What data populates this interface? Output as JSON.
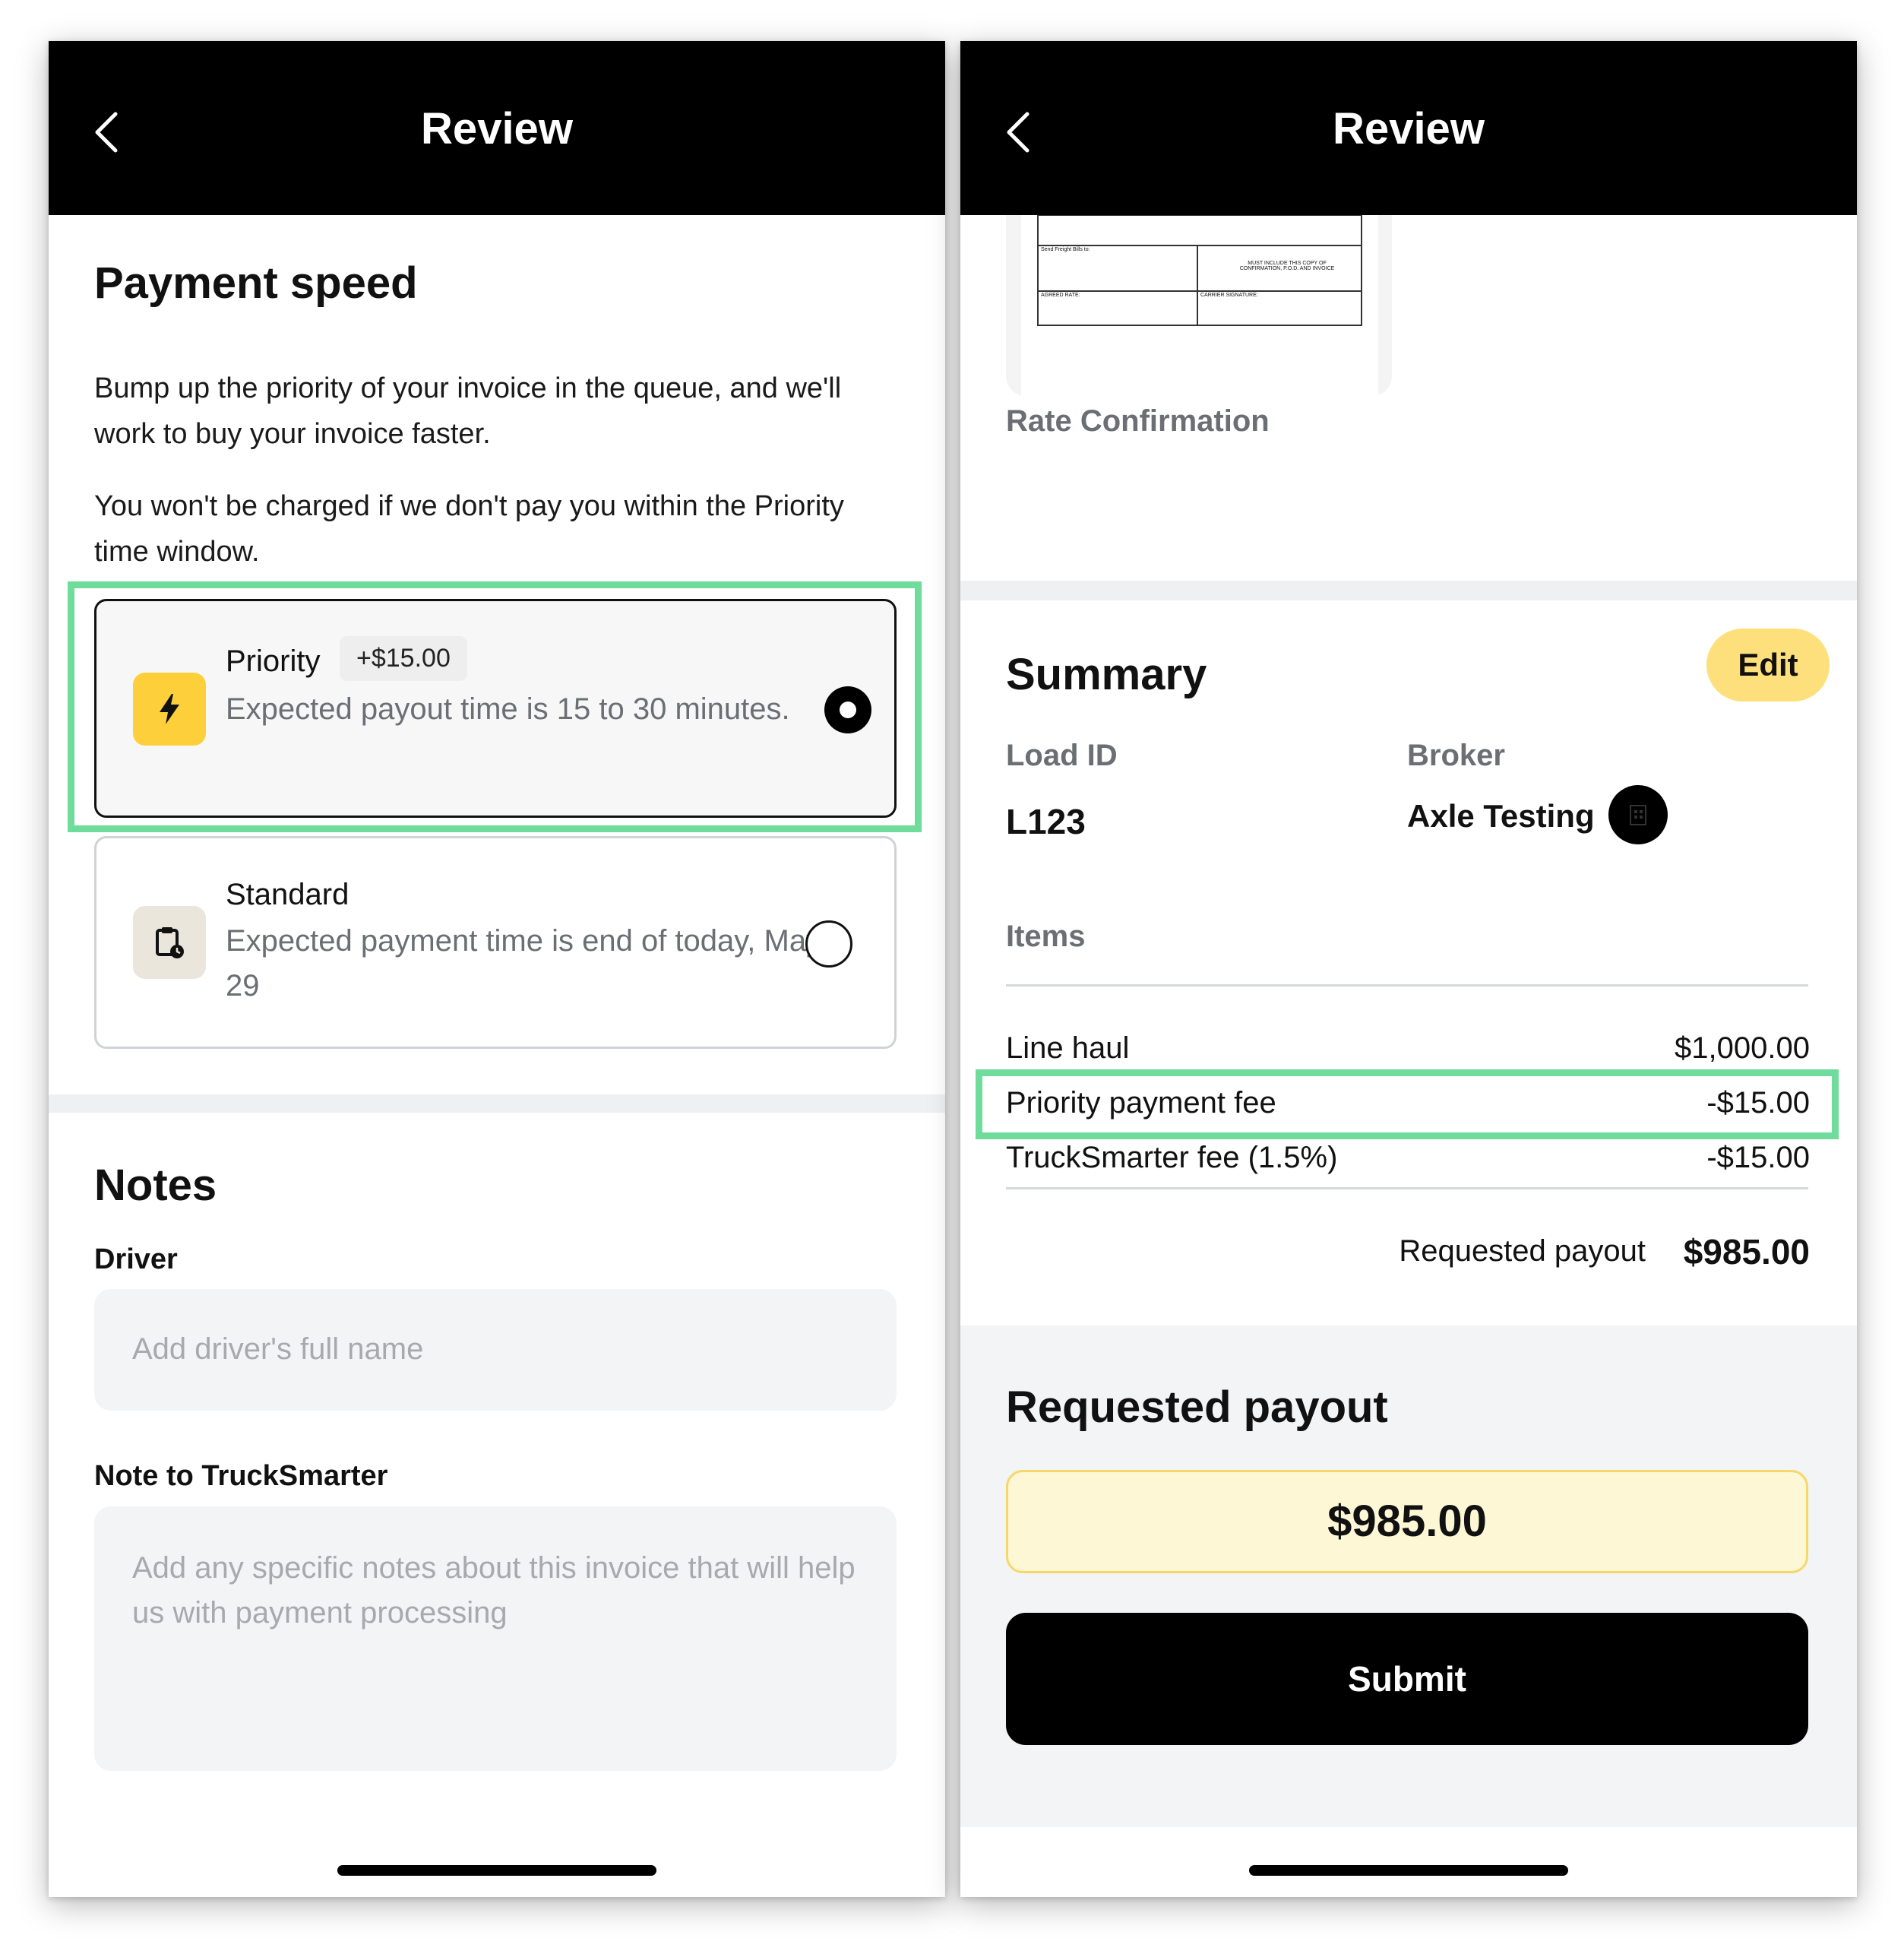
{
  "left": {
    "header": {
      "title": "Review"
    },
    "payment_speed": {
      "title": "Payment speed",
      "description": "Bump up the priority of your invoice in the queue, and we'll work to buy your invoice faster.",
      "note": "You won't be charged if we don't pay you within the Priority time window.",
      "options": [
        {
          "title": "Priority",
          "badge": "+$15.00",
          "description": "Expected payout time is 15 to 30 minutes.",
          "selected": true,
          "icon": "lightning-icon",
          "icon_bg": "#fdd03b"
        },
        {
          "title": "Standard",
          "description": "Expected payment time is end of today, May 29",
          "selected": false,
          "icon": "clipboard-clock-icon",
          "icon_bg": "#ebe6dc"
        }
      ]
    },
    "notes": {
      "title": "Notes",
      "driver_label": "Driver",
      "driver_placeholder": "Add driver's full name",
      "note_label": "Note to TruckSmarter",
      "note_placeholder": "Add any specific notes about this invoice that will help us with payment processing"
    }
  },
  "right": {
    "header": {
      "title": "Review"
    },
    "document": {
      "caption": "Rate Confirmation",
      "doc_text_1": "Send Freight Bills to:",
      "doc_text_2": "MUST INCLUDE THIS COPY OF CONFIRMATION, P.O.D. AND INVOICE",
      "doc_text_3": "AGREED RATE:",
      "doc_text_4": "CARRIER SIGNATURE:"
    },
    "summary": {
      "title": "Summary",
      "edit_label": "Edit",
      "load_id_label": "Load ID",
      "load_id": "L123",
      "broker_label": "Broker",
      "broker": "Axle Testing",
      "items_label": "Items",
      "items": [
        {
          "label": "Line haul",
          "amount": "$1,000.00"
        },
        {
          "label": "Priority payment fee",
          "amount": "-$15.00"
        },
        {
          "label": "TruckSmarter fee (1.5%)",
          "amount": "-$15.00"
        }
      ],
      "total_label": "Requested payout",
      "total": "$985.00"
    },
    "requested_payout": {
      "title": "Requested payout",
      "amount": "$985.00",
      "submit_label": "Submit"
    }
  },
  "colors": {
    "highlight": "#6fdc9c",
    "edit_button": "#fde07b",
    "payout_box_bg": "#fef7d6",
    "payout_box_border": "#f6d86a"
  }
}
